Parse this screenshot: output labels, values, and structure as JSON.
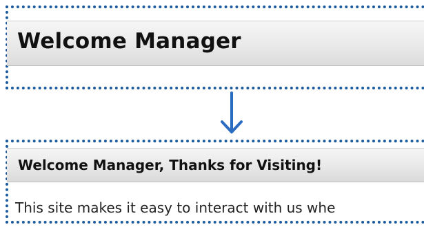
{
  "before": {
    "title": "Welcome Manager"
  },
  "after": {
    "title": "Welcome Manager, Thanks for Visiting!",
    "body": "This site makes it easy to interact with us whe"
  },
  "colors": {
    "dotted_border": "#1c5a9e",
    "arrow": "#2a6cc0",
    "bar_background": "#e9e9e9",
    "title_text": "#111111"
  },
  "icons": {
    "transition_arrow": "arrow-down-icon"
  }
}
